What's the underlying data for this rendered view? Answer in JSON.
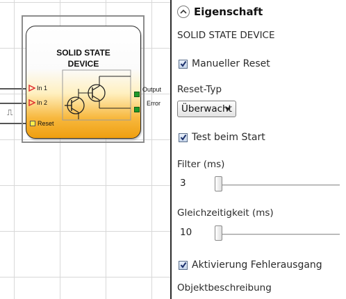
{
  "block": {
    "title": "SOLID STATE\nDEVICE",
    "inputs": [
      "In 1",
      "In 2",
      "Reset"
    ],
    "outputs": [
      "Output",
      "Error"
    ],
    "pulse_symbol": "⎍"
  },
  "panel": {
    "header": "Eigenschaft",
    "device_name": "SOLID STATE DEVICE",
    "manual_reset_label": "Manueller Reset",
    "manual_reset_checked": true,
    "reset_type_label": "Reset-Typ",
    "reset_type_value": "Überwacht",
    "test_start_label": "Test beim Start",
    "test_start_checked": true,
    "filter_label": "Filter (ms)",
    "filter_value": "3",
    "simultaneity_label": "Gleichzeitigkeit (ms)",
    "simultaneity_value": "10",
    "error_output_label": "Aktivierung Fehlerausgang",
    "error_output_checked": true,
    "description_label": "Objektbeschreibung"
  },
  "colors": {
    "block_orange": "#ef9f10",
    "reset_yellow": "#ffec4a",
    "output_green": "#1e9a2a",
    "input_arrow_red": "#e03030"
  },
  "icons": [
    "collapse-up-icon",
    "checkmark-icon",
    "dropdown-arrow-icon",
    "pulse-icon",
    "transistor-icon"
  ]
}
